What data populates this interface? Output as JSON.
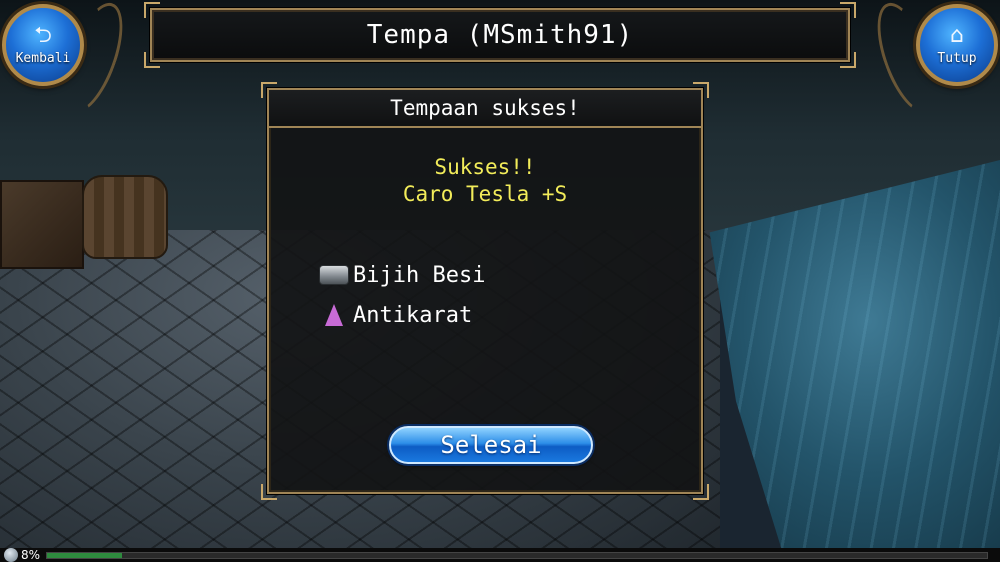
{
  "header": {
    "title": "Tempa  (MSmith91)"
  },
  "nav": {
    "back_label": "Kembali",
    "back_icon": "back-arrow-icon",
    "close_label": "Tutup",
    "close_icon": "home-icon"
  },
  "dialog": {
    "title": "Tempaan sukses!",
    "result_line1": "Sukses!!",
    "result_line2": "Caro Tesla +S",
    "materials": [
      {
        "label": "Bijih Besi",
        "icon": "iron-ore-icon"
      },
      {
        "label": "Antikarat",
        "icon": "potion-icon"
      }
    ],
    "done_label": "Selesai"
  },
  "status": {
    "progress_text": "8%",
    "progress_fraction": 0.08
  },
  "colors": {
    "accent_gold": "#a08556",
    "result_yellow": "#f2ec5a",
    "button_blue": "#1a79df",
    "progress_green": "#2e8b3e"
  }
}
